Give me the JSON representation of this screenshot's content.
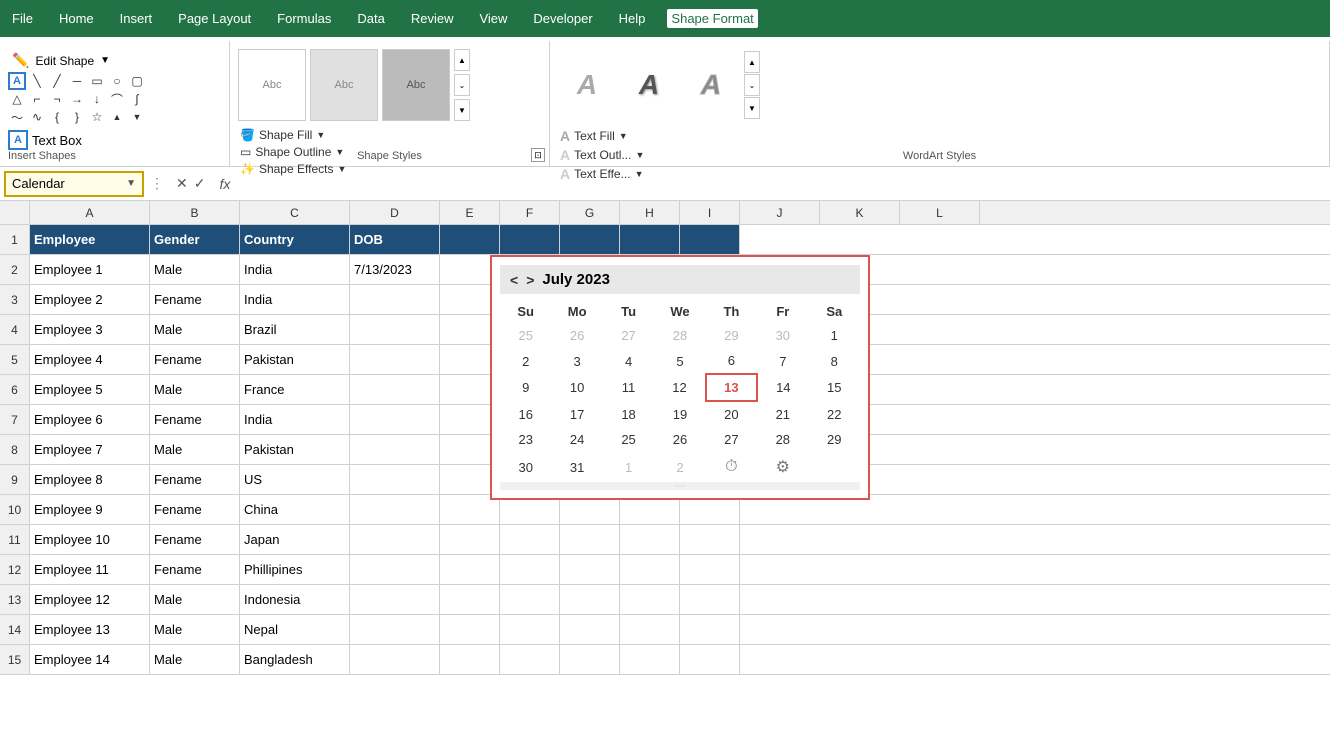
{
  "menuBar": {
    "items": [
      "File",
      "Home",
      "Insert",
      "Page Layout",
      "Formulas",
      "Data",
      "Review",
      "View",
      "Developer",
      "Help",
      "Shape Format"
    ],
    "active": "Shape Format"
  },
  "toolbar": {
    "insertShapes": {
      "label": "Insert Shapes",
      "textBoxLabel": "Text Box",
      "editShapeLabel": "Edit Shape",
      "editShapeArrow": "▼"
    },
    "shapeStyles": {
      "label": "Shape Styles",
      "shapeFill": "Shape Fill",
      "shapeOutline": "Shape Outline",
      "shapeEffects": "Shape Effects"
    },
    "wordArtStyles": {
      "label": "WordArt Styles",
      "textFill": "Text Fill",
      "textOutline": "Text Outl...",
      "textEffects": "Text Effe..."
    }
  },
  "formulaBar": {
    "nameBox": "Calendar",
    "crossIcon": "✕",
    "checkIcon": "✓",
    "fxLabel": "fx"
  },
  "columns": {
    "headers": [
      "A",
      "B",
      "C",
      "D",
      "E",
      "F",
      "G",
      "H",
      "I",
      "J",
      "K",
      "L"
    ]
  },
  "spreadsheet": {
    "headerRow": [
      "Employee",
      "Gender",
      "Country",
      "DOB"
    ],
    "rows": [
      [
        "Employee 1",
        "Male",
        "India",
        "7/13/2023"
      ],
      [
        "Employee 2",
        "Fename",
        "India",
        ""
      ],
      [
        "Employee 3",
        "Male",
        "Brazil",
        ""
      ],
      [
        "Employee 4",
        "Fename",
        "Pakistan",
        ""
      ],
      [
        "Employee 5",
        "Male",
        "France",
        ""
      ],
      [
        "Employee 6",
        "Fename",
        "India",
        ""
      ],
      [
        "Employee 7",
        "Male",
        "Pakistan",
        ""
      ],
      [
        "Employee 8",
        "Fename",
        "US",
        ""
      ],
      [
        "Employee 9",
        "Fename",
        "China",
        ""
      ],
      [
        "Employee 10",
        "Fename",
        "Japan",
        ""
      ],
      [
        "Employee 11",
        "Fename",
        "Phillipines",
        ""
      ],
      [
        "Employee 12",
        "Male",
        "Indonesia",
        ""
      ],
      [
        "Employee 13",
        "Male",
        "Nepal",
        ""
      ],
      [
        "Employee 14",
        "Male",
        "Bangladesh",
        ""
      ]
    ],
    "rowNumbers": [
      1,
      2,
      3,
      4,
      5,
      6,
      7,
      8,
      9,
      10,
      11,
      12,
      13,
      14,
      15
    ]
  },
  "calendar": {
    "title": "July 2023",
    "prevLabel": "<",
    "nextLabel": ">",
    "dayHeaders": [
      "Su",
      "Mo",
      "Tu",
      "We",
      "Th",
      "Fr",
      "Sa"
    ],
    "weeks": [
      [
        "25",
        "26",
        "27",
        "28",
        "29",
        "30",
        "1"
      ],
      [
        "2",
        "3",
        "4",
        "5",
        "6",
        "7",
        "8"
      ],
      [
        "9",
        "10",
        "11",
        "12",
        "13",
        "14",
        "15"
      ],
      [
        "16",
        "17",
        "18",
        "19",
        "20",
        "21",
        "22"
      ],
      [
        "23",
        "24",
        "25",
        "26",
        "27",
        "28",
        "29"
      ],
      [
        "30",
        "31",
        "1",
        "2",
        "⏱",
        "⚙",
        ""
      ]
    ],
    "weekClasses": [
      [
        "other-month",
        "other-month",
        "other-month",
        "other-month",
        "other-month",
        "other-month",
        ""
      ],
      [
        "",
        "",
        "",
        "",
        "",
        "",
        ""
      ],
      [
        "",
        "",
        "",
        "",
        "today",
        "",
        ""
      ],
      [
        "",
        "",
        "",
        "",
        "",
        "",
        ""
      ],
      [
        "",
        "",
        "",
        "",
        "",
        "",
        ""
      ],
      [
        "",
        "",
        "other-month",
        "other-month",
        "icon-cell",
        "icon-cell",
        ""
      ]
    ],
    "today": "13"
  }
}
